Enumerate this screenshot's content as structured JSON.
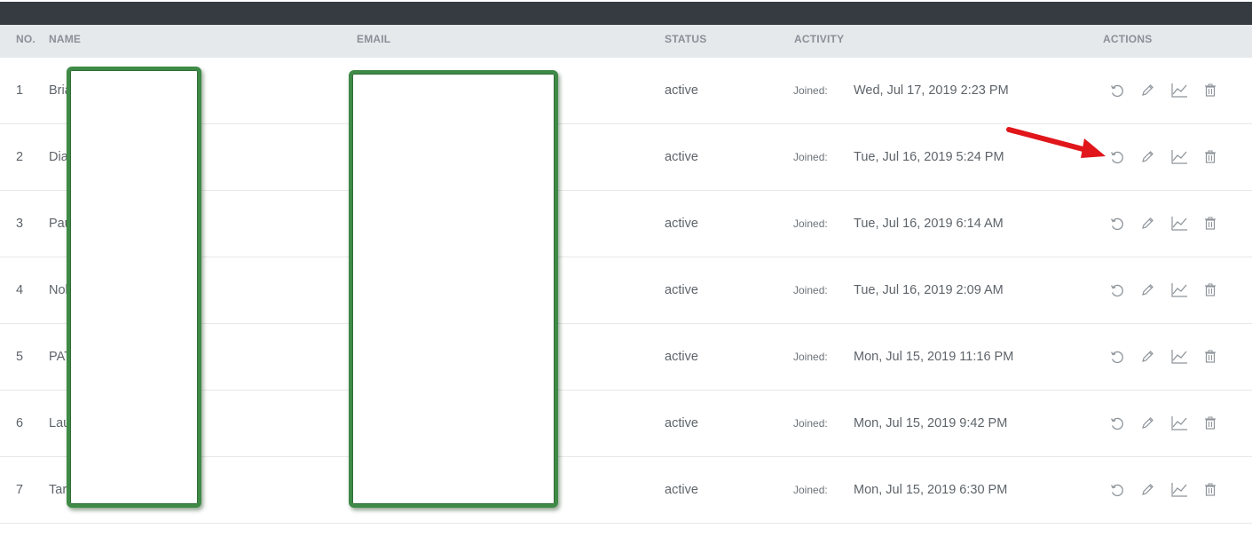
{
  "table": {
    "headers": {
      "no": "NO.",
      "name": "NAME",
      "email": "EMAIL",
      "status": "STATUS",
      "activity": "ACTIVITY",
      "actions": "ACTIONS"
    },
    "rows": [
      {
        "no": "1",
        "name": "Bria",
        "status": "active",
        "activity_label": "Joined:",
        "date": "Wed, Jul 17, 2019 2:23 PM"
      },
      {
        "no": "2",
        "name": "Dia",
        "status": "active",
        "activity_label": "Joined:",
        "date": "Tue, Jul 16, 2019 5:24 PM"
      },
      {
        "no": "3",
        "name": "Pau",
        "status": "active",
        "activity_label": "Joined:",
        "date": "Tue, Jul 16, 2019 6:14 AM"
      },
      {
        "no": "4",
        "name": "Nob",
        "status": "active",
        "activity_label": "Joined:",
        "date": "Tue, Jul 16, 2019 2:09 AM"
      },
      {
        "no": "5",
        "name": "PAT",
        "status": "active",
        "activity_label": "Joined:",
        "date": "Mon, Jul 15, 2019 11:16 PM"
      },
      {
        "no": "6",
        "name": "Lau",
        "status": "active",
        "activity_label": "Joined:",
        "date": "Mon, Jul 15, 2019 9:42 PM"
      },
      {
        "no": "7",
        "name": "Tara",
        "status": "active",
        "activity_label": "Joined:",
        "date": "Mon, Jul 15, 2019 6:30 PM"
      }
    ],
    "action_icons": [
      "reset-icon",
      "pencil-icon",
      "chart-line-icon",
      "trash-icon"
    ]
  },
  "colors": {
    "topbar": "#363b42",
    "header_bg": "#e6e9ec",
    "redaction_border": "#3e8a46",
    "annotation_arrow": "#e0161b"
  }
}
